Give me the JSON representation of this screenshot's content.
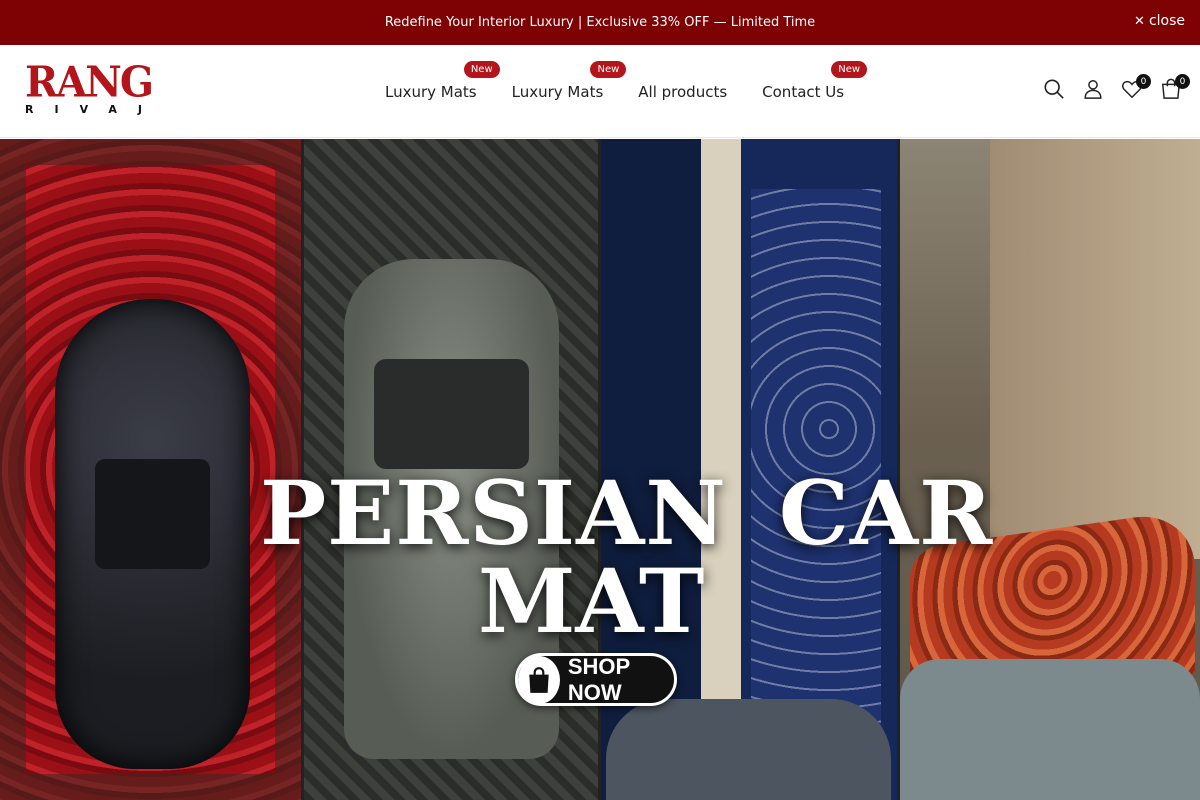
{
  "announcement": {
    "text": "Redefine Your Interior Luxury | Exclusive 33% OFF — Limited Time",
    "close_label": "close"
  },
  "logo": {
    "main": "RANG",
    "sub": "RIVAJ"
  },
  "nav": {
    "items": [
      {
        "label": "Luxury Mats",
        "badge": "New"
      },
      {
        "label": "Luxury Mats",
        "badge": "New"
      },
      {
        "label": "All products",
        "badge": ""
      },
      {
        "label": "Contact Us",
        "badge": "New"
      }
    ]
  },
  "header_icons": {
    "search": "search-icon",
    "account": "user-icon",
    "wishlist": "heart-icon",
    "cart": "bag-icon",
    "wishlist_count": "0",
    "cart_count": "0"
  },
  "hero": {
    "title_word1": "PERSIAN",
    "title_word2": "CAR",
    "title_word3": "MAT",
    "button_label": "SHOP NOW"
  },
  "colors": {
    "brand_red": "#b3151b",
    "announcement_bg": "#7e0103",
    "badge_bg": "#b3151b"
  }
}
